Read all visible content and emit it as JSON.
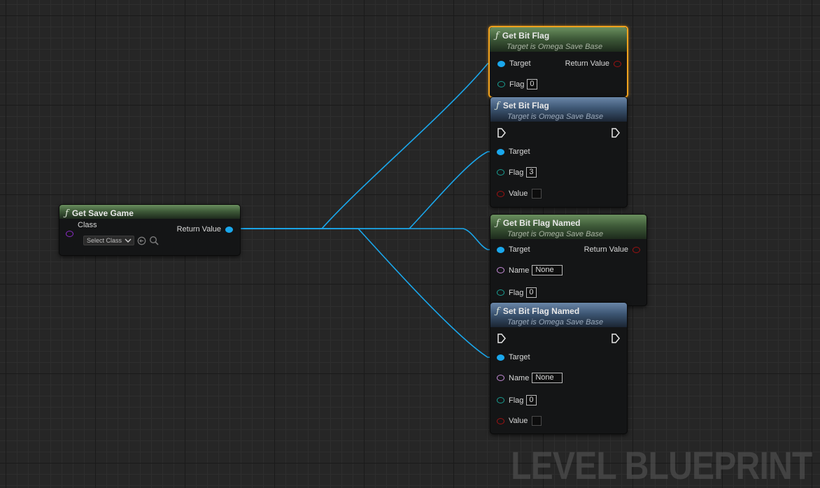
{
  "watermark": "LEVEL BLUEPRINT",
  "colors": {
    "object_pin": "#1aa7ec",
    "wire": "#1aa7ec",
    "integer_pin": "#1a9b8f",
    "bool_pin": "#9b1212",
    "name_pin": "#c48ad6",
    "class_pin": "#8b2bc7",
    "selection": "#f2a21d",
    "pure_header": "#4f6f49",
    "impure_header": "#4a6585"
  },
  "nodes": {
    "get_save_game": {
      "icon": "function-icon",
      "title": "Get Save Game",
      "class_label": "Class",
      "class_select": "Select Class",
      "return_label": "Return Value"
    },
    "get_bit_flag": {
      "icon": "function-icon",
      "title": "Get Bit Flag",
      "subtitle": "Target is Omega Save Base",
      "target_label": "Target",
      "return_label": "Return Value",
      "flag_label": "Flag",
      "flag_value": "0"
    },
    "set_bit_flag": {
      "icon": "function-icon",
      "title": "Set Bit Flag",
      "subtitle": "Target is Omega Save Base",
      "target_label": "Target",
      "flag_label": "Flag",
      "flag_value": "3",
      "value_label": "Value"
    },
    "get_bit_flag_named": {
      "icon": "function-icon",
      "title": "Get Bit Flag Named",
      "subtitle": "Target is Omega Save Base",
      "target_label": "Target",
      "return_label": "Return Value",
      "name_label": "Name",
      "name_value": "None",
      "flag_label": "Flag",
      "flag_value": "0"
    },
    "set_bit_flag_named": {
      "icon": "function-icon",
      "title": "Set Bit Flag Named",
      "subtitle": "Target is Omega Save Base",
      "target_label": "Target",
      "name_label": "Name",
      "name_value": "None",
      "flag_label": "Flag",
      "flag_value": "0",
      "value_label": "Value"
    }
  }
}
